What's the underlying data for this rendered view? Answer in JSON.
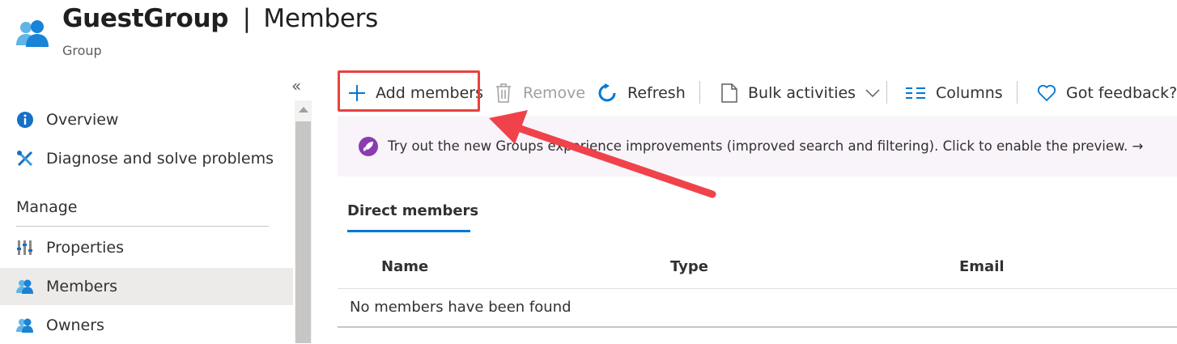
{
  "header": {
    "title_main": "GuestGroup",
    "title_sep": "|",
    "title_section": "Members",
    "subtitle": "Group",
    "icon": "group-icon"
  },
  "sidebar": {
    "collapse_glyph": "«",
    "items": [
      {
        "label": "Overview",
        "icon": "info-icon"
      },
      {
        "label": "Diagnose and solve problems",
        "icon": "tools-icon"
      }
    ],
    "section_label": "Manage",
    "manage_items": [
      {
        "label": "Properties",
        "icon": "properties-icon"
      },
      {
        "label": "Members",
        "icon": "members-icon",
        "active": true
      },
      {
        "label": "Owners",
        "icon": "owners-icon"
      }
    ]
  },
  "toolbar": {
    "add_members": "Add members",
    "remove": "Remove",
    "refresh": "Refresh",
    "bulk_activities": "Bulk activities",
    "columns": "Columns",
    "feedback": "Got feedback?"
  },
  "banner": {
    "text": "Try out the new Groups experience improvements (improved search and filtering). Click to enable the preview. →",
    "icon": "rocket-icon"
  },
  "tabs": [
    {
      "label": "Direct members",
      "active": true
    }
  ],
  "table": {
    "columns": [
      "Name",
      "Type",
      "Email"
    ],
    "empty_message": "No members have been found"
  },
  "colors": {
    "accent": "#0078d4",
    "highlight_border": "#e8423f",
    "arrow": "#f0424a",
    "banner_bg": "#f8f4fa",
    "rocket_bg": "#8a3cb0"
  }
}
